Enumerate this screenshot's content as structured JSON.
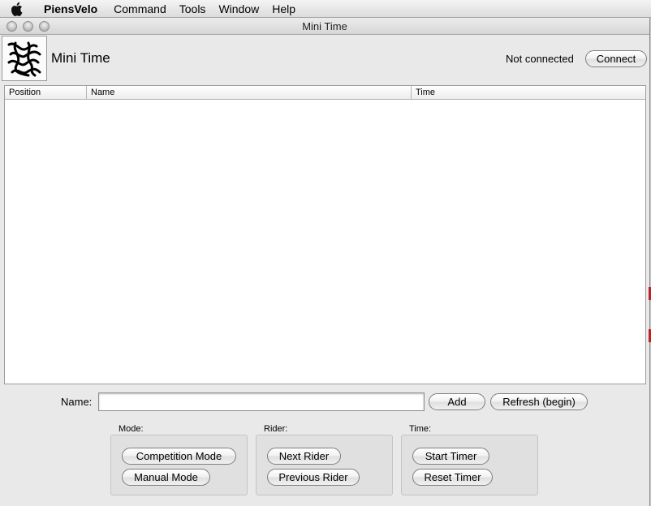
{
  "menubar": {
    "app_name": "PiensVelo",
    "items": [
      "Command",
      "Tools",
      "Window",
      "Help"
    ]
  },
  "window": {
    "title": "Mini Time"
  },
  "header": {
    "app_title": "Mini Time",
    "connection_status": "Not connected",
    "connect_label": "Connect"
  },
  "table": {
    "columns": [
      "Position",
      "Name",
      "Time"
    ],
    "rows": []
  },
  "entry": {
    "name_label": "Name:",
    "name_value": "",
    "add_label": "Add",
    "refresh_label": "Refresh (begin)"
  },
  "groups": {
    "mode": {
      "label": "Mode:",
      "buttons": [
        "Competition Mode",
        "Manual Mode"
      ]
    },
    "rider": {
      "label": "Rider:",
      "buttons": [
        "Next Rider",
        "Previous Rider"
      ]
    },
    "time": {
      "label": "Time:",
      "buttons": [
        "Start Timer",
        "Reset Timer"
      ]
    }
  },
  "icons": {
    "apple": "apple-icon",
    "logo": "app-logo-icon"
  }
}
